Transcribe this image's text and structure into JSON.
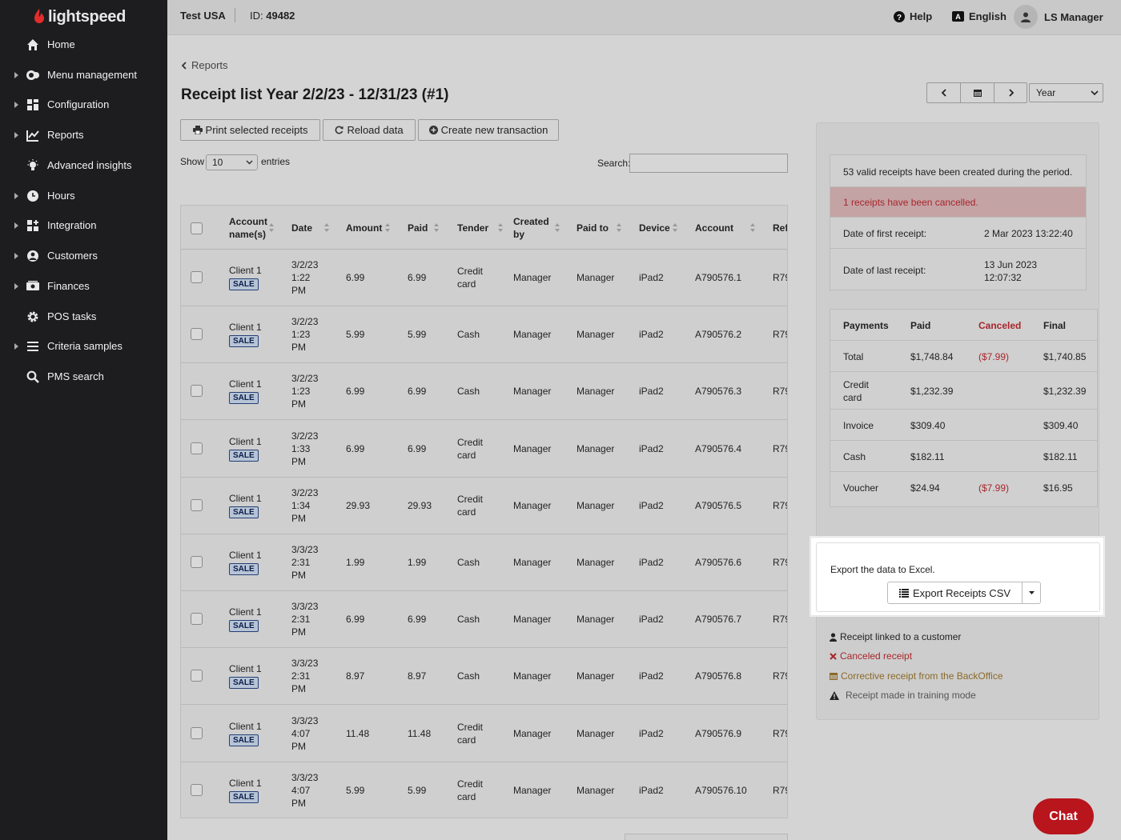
{
  "brand": {
    "name": "lightspeed",
    "accent": "#e22d2d"
  },
  "sidebar": {
    "items": [
      {
        "label": "Home",
        "icon": "home-icon",
        "expandable": false
      },
      {
        "label": "Menu management",
        "icon": "menu-management-icon",
        "expandable": true
      },
      {
        "label": "Configuration",
        "icon": "configuration-icon",
        "expandable": true
      },
      {
        "label": "Reports",
        "icon": "reports-icon",
        "expandable": true
      },
      {
        "label": "Advanced insights",
        "icon": "lightbulb-icon",
        "expandable": false
      },
      {
        "label": "Hours",
        "icon": "clock-icon",
        "expandable": true
      },
      {
        "label": "Integration",
        "icon": "integration-icon",
        "expandable": true
      },
      {
        "label": "Customers",
        "icon": "customer-icon",
        "expandable": true
      },
      {
        "label": "Finances",
        "icon": "finances-icon",
        "expandable": true
      },
      {
        "label": "POS tasks",
        "icon": "gear-icon",
        "expandable": false
      },
      {
        "label": "Criteria samples",
        "icon": "list-icon",
        "expandable": true
      },
      {
        "label": "PMS search",
        "icon": "search-icon",
        "expandable": false
      }
    ]
  },
  "topbar": {
    "store": "Test USA",
    "id_label": "ID:",
    "id_value": "49482",
    "help": "Help",
    "language": "English",
    "user": "LS Manager"
  },
  "page": {
    "back_label": "Reports",
    "title": "Receipt list Year 2/2/23 - 12/31/23 (#1)",
    "buttons": {
      "print": "Print selected receipts",
      "reload": "Reload data",
      "create": "Create new transaction"
    },
    "show_label": "Show",
    "show_value": "10",
    "entries_label": "entries",
    "search_label": "Search:",
    "search_value": "",
    "period": "Year"
  },
  "table": {
    "columns": {
      "account_a": "Account",
      "account_b": "name(s)",
      "date": "Date",
      "amount": "Amount",
      "paid": "Paid",
      "tender": "Tender",
      "created_a": "Created",
      "created_b": "by",
      "paid_to": "Paid to",
      "device": "Device",
      "account": "Account",
      "ref": "Ref"
    },
    "rows": [
      {
        "client": "Client 1",
        "badge": "SALE",
        "d1": "3/2/23",
        "d2": "1:22",
        "d3": "PM",
        "amount": "6.99",
        "paid": "6.99",
        "t1": "Credit",
        "t2": "card",
        "created": "Manager",
        "paid_to": "Manager",
        "device": "iPad2",
        "account": "A790576.1",
        "ref": "R79"
      },
      {
        "client": "Client 1",
        "badge": "SALE",
        "d1": "3/2/23",
        "d2": "1:23",
        "d3": "PM",
        "amount": "5.99",
        "paid": "5.99",
        "t1": "Cash",
        "t2": "",
        "created": "Manager",
        "paid_to": "Manager",
        "device": "iPad2",
        "account": "A790576.2",
        "ref": "R79"
      },
      {
        "client": "Client 1",
        "badge": "SALE",
        "d1": "3/2/23",
        "d2": "1:23",
        "d3": "PM",
        "amount": "6.99",
        "paid": "6.99",
        "t1": "Cash",
        "t2": "",
        "created": "Manager",
        "paid_to": "Manager",
        "device": "iPad2",
        "account": "A790576.3",
        "ref": "R79"
      },
      {
        "client": "Client 1",
        "badge": "SALE",
        "d1": "3/2/23",
        "d2": "1:33",
        "d3": "PM",
        "amount": "6.99",
        "paid": "6.99",
        "t1": "Credit",
        "t2": "card",
        "created": "Manager",
        "paid_to": "Manager",
        "device": "iPad2",
        "account": "A790576.4",
        "ref": "R79"
      },
      {
        "client": "Client 1",
        "badge": "SALE",
        "d1": "3/2/23",
        "d2": "1:34",
        "d3": "PM",
        "amount": "29.93",
        "paid": "29.93",
        "t1": "Credit",
        "t2": "card",
        "created": "Manager",
        "paid_to": "Manager",
        "device": "iPad2",
        "account": "A790576.5",
        "ref": "R79"
      },
      {
        "client": "Client 1",
        "badge": "SALE",
        "d1": "3/3/23",
        "d2": "2:31",
        "d3": "PM",
        "amount": "1.99",
        "paid": "1.99",
        "t1": "Cash",
        "t2": "",
        "created": "Manager",
        "paid_to": "Manager",
        "device": "iPad2",
        "account": "A790576.6",
        "ref": "R79"
      },
      {
        "client": "Client 1",
        "badge": "SALE",
        "d1": "3/3/23",
        "d2": "2:31",
        "d3": "PM",
        "amount": "6.99",
        "paid": "6.99",
        "t1": "Cash",
        "t2": "",
        "created": "Manager",
        "paid_to": "Manager",
        "device": "iPad2",
        "account": "A790576.7",
        "ref": "R79"
      },
      {
        "client": "Client 1",
        "badge": "SALE",
        "d1": "3/3/23",
        "d2": "2:31",
        "d3": "PM",
        "amount": "8.97",
        "paid": "8.97",
        "t1": "Cash",
        "t2": "",
        "created": "Manager",
        "paid_to": "Manager",
        "device": "iPad2",
        "account": "A790576.8",
        "ref": "R79"
      },
      {
        "client": "Client 1",
        "badge": "SALE",
        "d1": "3/3/23",
        "d2": "4:07",
        "d3": "PM",
        "amount": "11.48",
        "paid": "11.48",
        "t1": "Credit",
        "t2": "card",
        "created": "Manager",
        "paid_to": "Manager",
        "device": "iPad2",
        "account": "A790576.9",
        "ref": "R79"
      },
      {
        "client": "Client 1",
        "badge": "SALE",
        "d1": "3/3/23",
        "d2": "4:07",
        "d3": "PM",
        "amount": "5.99",
        "paid": "5.99",
        "t1": "Credit",
        "t2": "card",
        "created": "Manager",
        "paid_to": "Manager",
        "device": "iPad2",
        "account": "A790576.10",
        "ref": "R79"
      }
    ]
  },
  "summary": {
    "valid": "53 valid receipts have been created during the period.",
    "cancelled": "1 receipts have been cancelled.",
    "first_label": "Date of first receipt:",
    "first_value": "2 Mar 2023 13:22:40",
    "last_label": "Date of last receipt:",
    "last_value_1": "13 Jun 2023",
    "last_value_2": "12:07:32"
  },
  "payments": {
    "headers": {
      "payments": "Payments",
      "paid": "Paid",
      "canceled": "Canceled",
      "final": "Final"
    },
    "rows": [
      {
        "name": "Total",
        "name2": "",
        "paid": "$1,748.84",
        "canceled": "($7.99)",
        "final": "$1,740.85"
      },
      {
        "name": "Credit",
        "name2": "card",
        "paid": "$1,232.39",
        "canceled": "",
        "final": "$1,232.39"
      },
      {
        "name": "Invoice",
        "name2": "",
        "paid": "$309.40",
        "canceled": "",
        "final": "$309.40"
      },
      {
        "name": "Cash",
        "name2": "",
        "paid": "$182.11",
        "canceled": "",
        "final": "$182.11"
      },
      {
        "name": "Voucher",
        "name2": "",
        "paid": "$24.94",
        "canceled": "($7.99)",
        "final": "$16.95"
      }
    ]
  },
  "export": {
    "text": "Export the data to Excel.",
    "button": "Export Receipts CSV"
  },
  "legend": {
    "linked": "Receipt linked to a customer",
    "canceled": "Canceled receipt",
    "corrective": "Corrective receipt from the BackOffice",
    "training": "Receipt made in training mode"
  },
  "chat": "Chat",
  "colors": {
    "cancel_red": "#a8262b",
    "corrective_brown": "#8a6a28",
    "chat_red": "#b8151d"
  }
}
